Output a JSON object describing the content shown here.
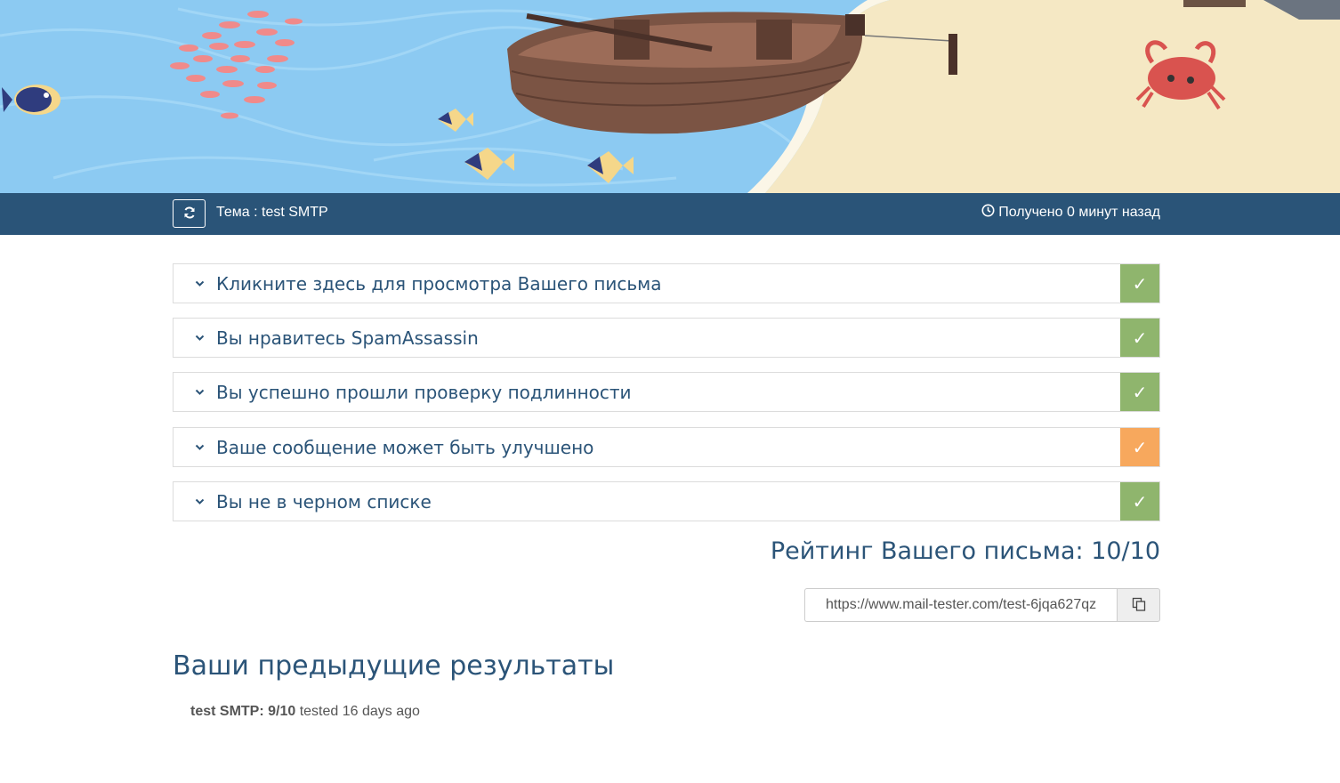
{
  "topbar": {
    "subject": "Тема : test SMTP",
    "received": "Получено 0 минут назад"
  },
  "results": [
    {
      "title": "Кликните здесь для просмотра Вашего письма",
      "status": "ok",
      "mark": "✓"
    },
    {
      "title": "Вы нравитесь SpamAssassin",
      "status": "ok",
      "mark": "✓"
    },
    {
      "title": "Вы успешно прошли проверку подлинности",
      "status": "ok",
      "mark": "✓"
    },
    {
      "title": "Ваше сообщение может быть улучшено",
      "status": "warn",
      "mark": "✓"
    },
    {
      "title": "Вы не в черном списке",
      "status": "ok",
      "mark": "✓"
    }
  ],
  "rating": {
    "text": "Рейтинг Вашего письма: 10/10"
  },
  "share": {
    "url": "https://www.mail-tester.com/test-6jqa627qz"
  },
  "previous": {
    "title": "Ваши предыдущие результаты",
    "items": [
      {
        "label": "test SMTP: 9/10",
        "suffix": " tested 16 days ago"
      }
    ]
  },
  "colors": {
    "header_bar": "#2a5478",
    "status_ok": "#8fb56d",
    "status_warn": "#f7a85d",
    "text_primary": "#2b5478",
    "sea": "#8ccaf2",
    "sand": "#f5e8c4"
  },
  "icons": {
    "refresh": "refresh-icon",
    "clock": "clock-icon",
    "chevron": "chevron-down-icon",
    "check": "check-icon",
    "copy": "copy-icon"
  }
}
